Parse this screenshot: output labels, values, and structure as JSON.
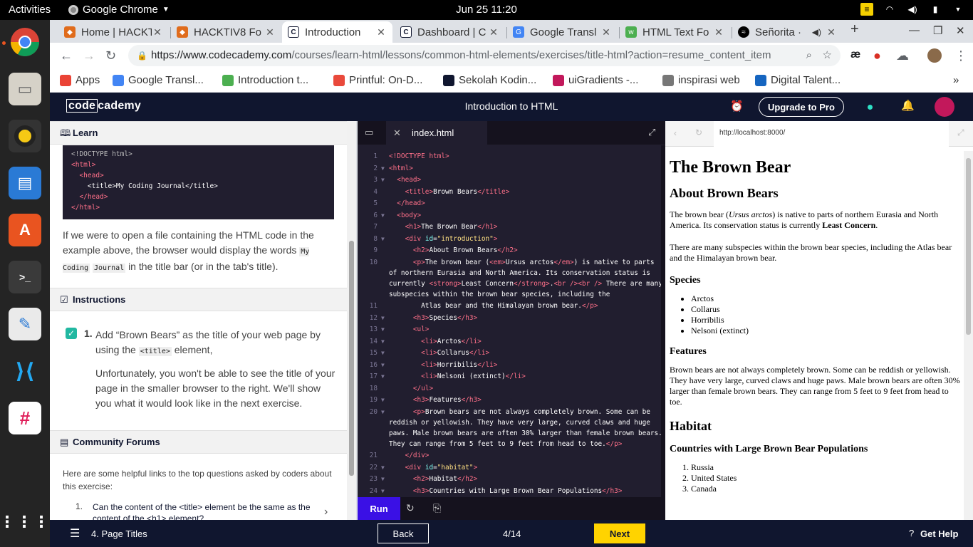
{
  "system": {
    "activities": "Activities",
    "app_name": "Google Chrome",
    "clock": "Jun 25  11:20"
  },
  "browser": {
    "tabs": [
      {
        "label": "Home | HACKT",
        "color": "#e06c1c"
      },
      {
        "label": "HACKTIV8 Fo",
        "color": "#e06c1c"
      },
      {
        "label": "Introduction",
        "color": "#10162f",
        "active": true
      },
      {
        "label": "Dashboard | C",
        "color": "#10162f"
      },
      {
        "label": "Google Transl",
        "color": "#4285f4"
      },
      {
        "label": "HTML Text Fo",
        "color": "#4caf50"
      },
      {
        "label": "Señorita ·",
        "color": "#1db954"
      }
    ],
    "url_host": "https://www.codecademy.com",
    "url_path": "/courses/learn-html/lessons/common-html-elements/exercises/title-html?action=resume_content_item",
    "bookmarks": [
      {
        "label": "Apps",
        "color": "#ea4335"
      },
      {
        "label": "Google Transl...",
        "color": "#4285f4"
      },
      {
        "label": "Introduction t...",
        "color": "#4caf50"
      },
      {
        "label": "Printful: On-D...",
        "color": "#e9493b"
      },
      {
        "label": "Sekolah Kodin...",
        "color": "#10162f"
      },
      {
        "label": "uiGradients -...",
        "color": "#c2185b"
      },
      {
        "label": "inspirasi web",
        "color": "#777777"
      },
      {
        "label": "Digital Talent...",
        "color": "#1565c0"
      }
    ]
  },
  "codecademy": {
    "logo_code": "code",
    "logo_rest": "cademy",
    "title": "Introduction to HTML",
    "upgrade": "Upgrade to Pro"
  },
  "learn": {
    "heading": "Learn",
    "example_code": [
      "<!DOCTYPE html>",
      "<html>",
      "  <head>",
      "    <title>My Coding Journal</title>",
      "  </head>",
      "</html>"
    ],
    "paragraph_before": "If we were to open a file containing the HTML code in the example above, the browser would display the words",
    "inline_code_1": "My Coding",
    "inline_code_2": "Journal",
    "paragraph_after": "in the title bar (or in the tab's title).",
    "instructions_heading": "Instructions",
    "task_number": "1.",
    "task_text_1": "Add “Brown Bears” as the title of your web page by using the",
    "task_code": "<title>",
    "task_text_2": "element,",
    "task_note": "Unfortunately, you won't be able to see the title of your page in the smaller browser to the right. We'll show you what it would look like in the next exercise.",
    "forums_heading": "Community Forums",
    "forums_intro": "Here are some helpful links to the top questions asked by coders about this exercise:",
    "forum_q1_number": "1.",
    "forum_q1": "Can the content of the <title> element be the same as the content of the <h1> element?"
  },
  "editor": {
    "filename": "index.html",
    "run": "Run",
    "lines": [
      {
        "n": "1",
        "html": "<span class=\"c-tag\">&lt;!DOCTYPE html&gt;</span>"
      },
      {
        "n": "2",
        "fold": true,
        "html": "<span class=\"c-tag\">&lt;html&gt;</span>"
      },
      {
        "n": "3",
        "fold": true,
        "html": "  <span class=\"c-tag\">&lt;head&gt;</span>"
      },
      {
        "n": "4",
        "html": "    <span class=\"c-tag\">&lt;title&gt;</span>Brown Bears<span class=\"c-tag\">&lt;/title&gt;</span>"
      },
      {
        "n": "5",
        "html": "  <span class=\"c-tag\">&lt;/head&gt;</span>"
      },
      {
        "n": "6",
        "fold": true,
        "html": "  <span class=\"c-tag\">&lt;body&gt;</span>"
      },
      {
        "n": "7",
        "html": "    <span class=\"c-tag\">&lt;h1&gt;</span>The Brown Bear<span class=\"c-tag\">&lt;/h1&gt;</span>"
      },
      {
        "n": "8",
        "fold": true,
        "html": "    <span class=\"c-tag\">&lt;div</span> <span class=\"c-attr\">id</span>=<span class=\"c-str\">\"introduction\"</span><span class=\"c-tag\">&gt;</span>"
      },
      {
        "n": "9",
        "html": "      <span class=\"c-tag\">&lt;h2&gt;</span>About Brown Bears<span class=\"c-tag\">&lt;/h2&gt;</span>"
      },
      {
        "n": "10",
        "rows": 4,
        "html": "      <span class=\"c-tag\">&lt;p&gt;</span>The brown bear (<span class=\"c-tag\">&lt;em&gt;</span>Ursus arctos<span class=\"c-tag\">&lt;/em&gt;</span>) is native to parts of northern Eurasia and North America. Its conservation status is currently <span class=\"c-tag\">&lt;strong&gt;</span>Least Concern<span class=\"c-tag\">&lt;/strong&gt;</span>.<span class=\"c-tag\">&lt;br /&gt;&lt;br /&gt;</span> There are many subspecies within the brown bear species, including the"
      },
      {
        "n": "11",
        "html": "        Atlas bear and the Himalayan brown bear.<span class=\"c-tag\">&lt;/p&gt;</span>"
      },
      {
        "n": "12",
        "fold": true,
        "html": "      <span class=\"c-tag\">&lt;h3&gt;</span>Species<span class=\"c-tag\">&lt;/h3&gt;</span>"
      },
      {
        "n": "13",
        "fold": true,
        "html": "      <span class=\"c-tag\">&lt;ul&gt;</span>"
      },
      {
        "n": "14",
        "fold": true,
        "html": "        <span class=\"c-tag\">&lt;li&gt;</span>Arctos<span class=\"c-tag\">&lt;/li&gt;</span>"
      },
      {
        "n": "15",
        "fold": true,
        "html": "        <span class=\"c-tag\">&lt;li&gt;</span>Collarus<span class=\"c-tag\">&lt;/li&gt;</span>"
      },
      {
        "n": "16",
        "fold": true,
        "html": "        <span class=\"c-tag\">&lt;li&gt;</span>Horribilis<span class=\"c-tag\">&lt;/li&gt;</span>"
      },
      {
        "n": "17",
        "fold": true,
        "html": "        <span class=\"c-tag\">&lt;li&gt;</span>Nelsoni (extinct)<span class=\"c-tag\">&lt;/li&gt;</span>"
      },
      {
        "n": "18",
        "html": "      <span class=\"c-tag\">&lt;/ul&gt;</span>"
      },
      {
        "n": "19",
        "fold": true,
        "html": "      <span class=\"c-tag\">&lt;h3&gt;</span>Features<span class=\"c-tag\">&lt;/h3&gt;</span>"
      },
      {
        "n": "20",
        "fold": true,
        "rows": 4,
        "html": "      <span class=\"c-tag\">&lt;p&gt;</span>Brown bears are not always completely brown. Some can be reddish or yellowish. They have very large, curved claws and huge paws. Male brown bears are often 30% larger than female brown bears. They can range from 5 feet to 9 feet from head to toe.<span class=\"c-tag\">&lt;/p&gt;</span>"
      },
      {
        "n": "21",
        "html": "    <span class=\"c-tag\">&lt;/div&gt;</span>"
      },
      {
        "n": "22",
        "fold": true,
        "html": "    <span class=\"c-tag\">&lt;div</span> <span class=\"c-attr\">id</span>=<span class=\"c-str\">\"habitat\"</span><span class=\"c-tag\">&gt;</span>"
      },
      {
        "n": "23",
        "fold": true,
        "html": "      <span class=\"c-tag\">&lt;h2&gt;</span>Habitat<span class=\"c-tag\">&lt;/h2&gt;</span>"
      },
      {
        "n": "24",
        "fold": true,
        "html": "      <span class=\"c-tag\">&lt;h3&gt;</span>Countries with Large Brown Bear Populations<span class=\"c-tag\">&lt;/h3&gt;</span>"
      }
    ]
  },
  "preview": {
    "url": "http://localhost:8000/",
    "h1": "The Brown Bear",
    "h2_about": "About Brown Bears",
    "p1_a": "The brown bear (",
    "p1_em": "Ursus arctos",
    "p1_b": ") is native to parts of northern Eurasia and North America. Its conservation status is currently",
    "p1_strong": "Least Concern",
    "p1_end": ".",
    "p2": "There are many subspecies within the brown bear species, including the Atlas bear and the Himalayan brown bear.",
    "species_heading": "Species",
    "species": [
      "Arctos",
      "Collarus",
      "Horribilis",
      "Nelsoni (extinct)"
    ],
    "features_heading": "Features",
    "features_text": "Brown bears are not always completely brown. Some can be reddish or yellowish. They have very large, curved claws and huge paws. Male brown bears are often 30% larger than female brown bears. They can range from 5 feet to 9 feet from head to toe.",
    "habitat_heading": "Habitat",
    "countries_heading": "Countries with Large Brown Bear Populations",
    "countries": [
      "Russia",
      "United States",
      "Canada"
    ]
  },
  "footer": {
    "page_label": "4. Page Titles",
    "back": "Back",
    "progress": "4/14",
    "next": "Next",
    "help": "Get Help"
  }
}
